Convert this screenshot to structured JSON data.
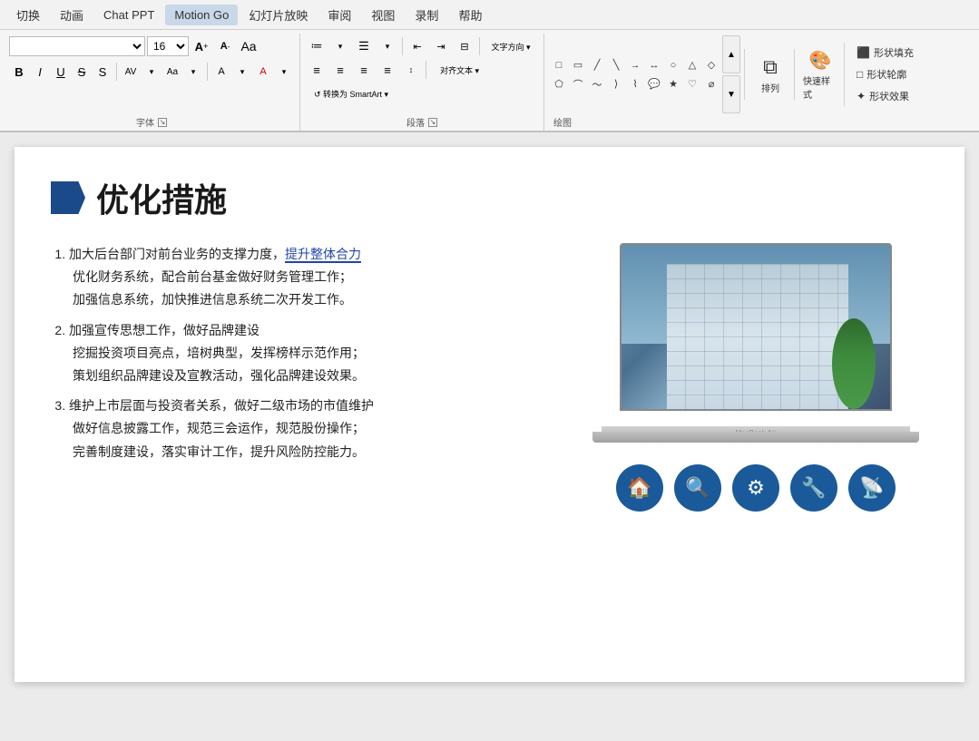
{
  "app": {
    "title": "Motion Go"
  },
  "menubar": {
    "items": [
      "切换",
      "动画",
      "Chat PPT",
      "Motion Go",
      "幻灯片放映",
      "审阅",
      "视图",
      "录制",
      "帮助"
    ]
  },
  "ribbon": {
    "font_section": {
      "label": "字体",
      "font_name": "",
      "font_size": "16",
      "btns": [
        "A↑",
        "A↓",
        "Aa"
      ],
      "format_btns": [
        "B",
        "I",
        "U",
        "S",
        "A"
      ],
      "color_label": "A",
      "expand_icon": "↘"
    },
    "paragraph_section": {
      "label": "段落",
      "expand_icon": "↘",
      "list_btns": [
        "☰▾",
        "☰▾"
      ],
      "indent_btns": [
        "←▌",
        "▌→",
        "↔"
      ],
      "text_dir_label": "文字方向",
      "align_text_label": "对齐文本",
      "smartart_label": "转换为 SmartArt",
      "align_btns": [
        "≡",
        "≡",
        "≡",
        "≡",
        "☰"
      ]
    },
    "drawing_section": {
      "label": "绘图",
      "shapes": [
        "□",
        "△",
        "○",
        "◇",
        "→",
        "▷",
        "⬟",
        "⬠",
        "⌒",
        "╱",
        "╲",
        "╱",
        "ᗒ",
        "ᗕ",
        "⟨",
        "⟩",
        "⌇",
        "〇"
      ],
      "arrange_label": "排列",
      "quick_style_label": "快速样式",
      "shape_fill_label": "形状填充",
      "shape_outline_label": "形状轮廓",
      "shape_effect_label": "形状效果"
    }
  },
  "slide": {
    "title": "优化措施",
    "items": [
      {
        "number": "1",
        "main": "加大后台部门对前台业务的支撑力度，提升整体合力",
        "details": [
          "优化财务系统，配合前台基金做好财务管理工作；",
          "加强信息系统，加快推进信息系统二次开发工作。"
        ]
      },
      {
        "number": "2",
        "main": "加强宣传思想工作，做好品牌建设",
        "details": [
          "挖掘投资项目亮点，培树典型，发挥榜样示范作用；",
          "策划组织品牌建设及宣教活动，强化品牌建设效果。"
        ]
      },
      {
        "number": "3",
        "main": "维护上市层面与投资者关系，做好二级市场的市值维护",
        "details": [
          "做好信息披露工作，规范三会运作，规范股份操作；",
          "完善制度建设，落实审计工作，提升风险防控能力。"
        ]
      }
    ],
    "icons": [
      "🏠",
      "🔍",
      "⚙",
      "🔧",
      "📡"
    ]
  }
}
